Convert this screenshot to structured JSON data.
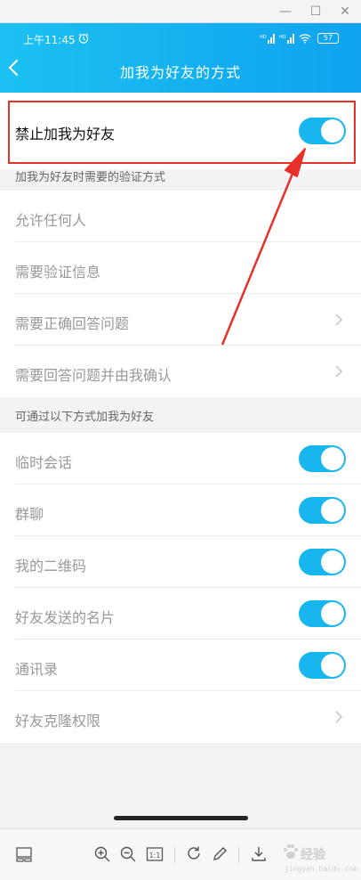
{
  "status_bar": {
    "time": "上午11:45",
    "signal1": "HD",
    "signal2": "HD",
    "battery": "57"
  },
  "header": {
    "title": "加我为好友的方式"
  },
  "main_toggle": {
    "label": "禁止加我为好友",
    "on": true
  },
  "section1": {
    "title": "加我为好友时需要的验证方式",
    "items": [
      {
        "label": "允许任何人"
      },
      {
        "label": "需要验证信息"
      },
      {
        "label": "需要正确回答问题"
      },
      {
        "label": "需要回答问题并由我确认"
      }
    ]
  },
  "section2": {
    "title": "可通过以下方式加我为好友",
    "items": [
      {
        "label": "临时会话",
        "on": true
      },
      {
        "label": "群聊",
        "on": true
      },
      {
        "label": "我的二维码",
        "on": true
      },
      {
        "label": "好友发送的名片",
        "on": true
      },
      {
        "label": "通讯录",
        "on": true
      },
      {
        "label": "好友克隆权限"
      }
    ]
  },
  "toolbar": {
    "zoom_actual_label": "1:1"
  },
  "watermark": {
    "text": "经验",
    "sub": "jingyan.baidu.com"
  },
  "colors": {
    "header_start": "#1cc1f2",
    "header_end": "#11a3ef",
    "toggle_on": "#18b6ee",
    "highlight": "#e7302a"
  }
}
